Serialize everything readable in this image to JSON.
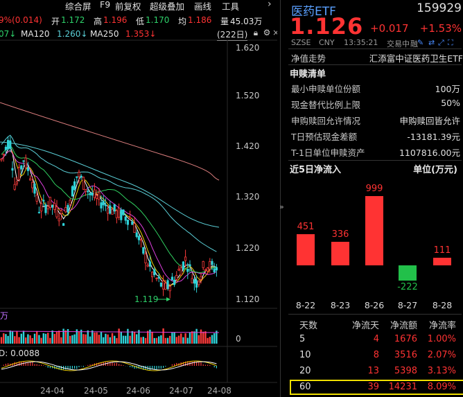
{
  "topbar": {
    "pct": "9%(0.014)",
    "open_label": "开",
    "open_val": "1.172",
    "high_label": "高",
    "high_val": "1.196",
    "low_label": "低",
    "low_val": "1.170",
    "avg_label": "均",
    "avg_val": "1.186",
    "vol_label": "量",
    "vol_val": "45.03万",
    "menu": [
      "综合屏",
      "F9",
      "前复权",
      "超级叠加",
      "画线",
      "工具"
    ],
    "more": "›"
  },
  "ma": {
    "first": "07↓",
    "ma120_label": "MA120",
    "ma120_val": "1.260↓",
    "ma250_label": "MA250",
    "ma250_val": "1.353↓",
    "days_btn": "(222日)"
  },
  "yaxis": [
    "1.620",
    "1.520",
    "1.420",
    "1.320",
    "1.220",
    "1.120"
  ],
  "low_mark": "1.119",
  "volume": {
    "unit_frag": "万",
    "zero": "0"
  },
  "macd": {
    "label_frag": "D: 0.0088"
  },
  "xaxis": [
    "24-04",
    "24-05",
    "24-06",
    "24-07",
    "24-08"
  ],
  "quote": {
    "name": "医药ETF",
    "code": "159929",
    "price": "1.126",
    "change": "+0.017",
    "change_pct": "+1.53%",
    "market": "SZSE",
    "currency": "CNY",
    "time": "13:35:21",
    "status": "交易中",
    "extra": "融"
  },
  "nav": {
    "label": "净值走势",
    "fund_name": "汇添富中证医药卫生ETF"
  },
  "redeem": {
    "title": "申赎清单",
    "rows": [
      {
        "label": "最小申赎单位份额",
        "value": "100万"
      },
      {
        "label": "现金替代比例上限",
        "value": "50%"
      },
      {
        "label": "申购赎回允许情况",
        "value": "申购赎回皆允许"
      },
      {
        "label": "T日预估现金差额",
        "value": "-13181.39元"
      },
      {
        "label": "T-1日单位申赎资产",
        "value": "1107816.00元"
      }
    ]
  },
  "flow": {
    "title": "近5日净流入",
    "unit": "单位(万元)",
    "dates": [
      "8-22",
      "8-23",
      "8-26",
      "8-27",
      "8-28"
    ],
    "values": [
      "451",
      "336",
      "999",
      "-222",
      "111"
    ]
  },
  "flow_table": {
    "headers": [
      "天数",
      "净流天",
      "净流额",
      "净流率"
    ],
    "rows": [
      [
        "5",
        "4",
        "1676",
        "1.00%"
      ],
      [
        "10",
        "8",
        "3516",
        "2.07%"
      ],
      [
        "20",
        "13",
        "5398",
        "3.13%"
      ],
      [
        "60",
        "39",
        "14231",
        "8.09%"
      ]
    ]
  },
  "colors": {
    "up": "#ff3333",
    "down": "#22c04a",
    "highlight": "#f0e000",
    "name_blue": "#5aa0ff"
  },
  "chart_data": {
    "type": "bar",
    "categories": [
      "8-22",
      "8-23",
      "8-26",
      "8-27",
      "8-28"
    ],
    "values": [
      451,
      336,
      999,
      -222,
      111
    ],
    "title": "近5日净流入",
    "ylabel": "单位(万元)"
  }
}
